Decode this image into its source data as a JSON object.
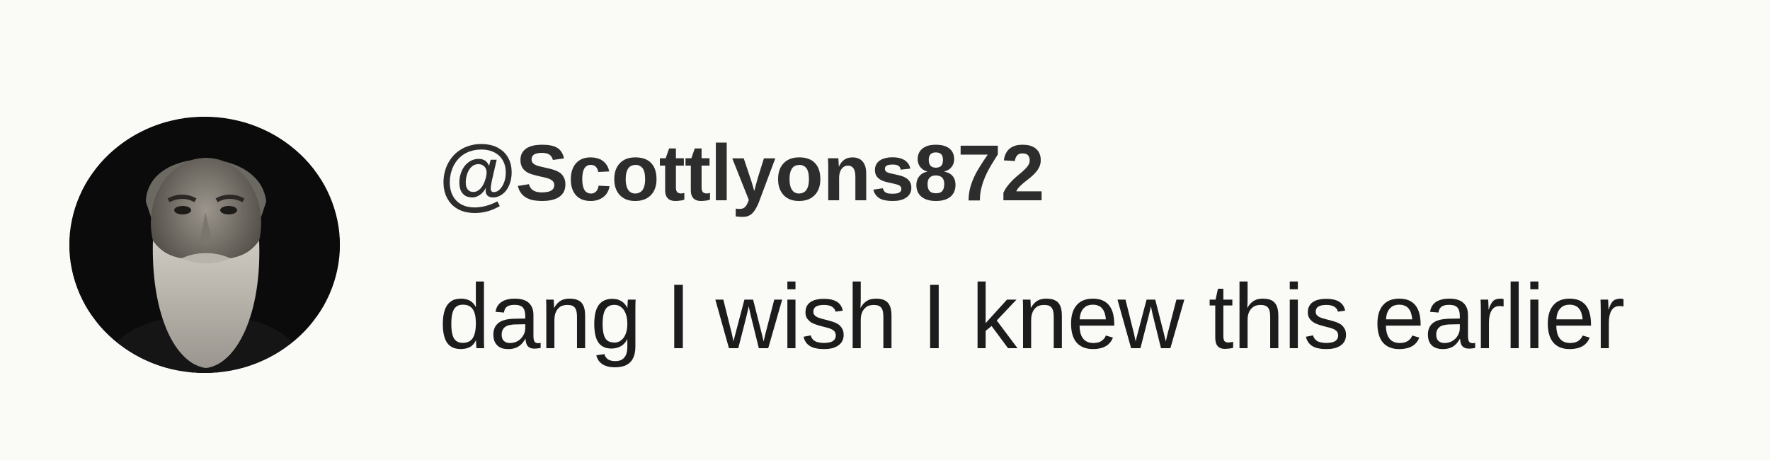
{
  "comment": {
    "username": "@Scottlyons872",
    "text": "dang I wish I knew this earlier",
    "avatar_icon": "avatar-icon"
  },
  "colors": {
    "background": "#fafaf7",
    "username": "#2d2d2d",
    "text": "#1c1c1c",
    "avatar_bg": "#0b0b0b"
  }
}
